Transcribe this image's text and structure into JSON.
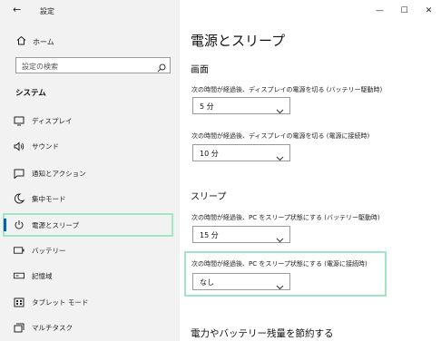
{
  "titlebar": {
    "back_glyph": "←",
    "app_title": "設定"
  },
  "window_controls": {
    "minimize": "—",
    "maximize": "☐",
    "close": "✕"
  },
  "sidebar": {
    "home_label": "ホーム",
    "search_placeholder": "設定の検索",
    "section_title": "システム",
    "items": [
      {
        "label": "ディスプレイ",
        "icon": "monitor-icon"
      },
      {
        "label": "サウンド",
        "icon": "speaker-icon"
      },
      {
        "label": "通知とアクション",
        "icon": "notification-icon"
      },
      {
        "label": "集中モード",
        "icon": "moon-icon"
      },
      {
        "label": "電源とスリープ",
        "icon": "power-icon",
        "selected": true
      },
      {
        "label": "バッテリー",
        "icon": "battery-icon"
      },
      {
        "label": "記憶域",
        "icon": "storage-icon"
      },
      {
        "label": "タブレット モード",
        "icon": "tablet-icon"
      },
      {
        "label": "マルチタスク",
        "icon": "multitask-icon"
      }
    ]
  },
  "main": {
    "page_title": "電源とスリープ",
    "screen": {
      "heading": "画面",
      "battery_label": "次の時間が経過後、ディスプレイの電源を切る (バッテリー駆動時)",
      "battery_value": "5 分",
      "plugged_label": "次の時間が経過後、ディスプレイの電源を切る (電源に接続時)",
      "plugged_value": "10 分"
    },
    "sleep": {
      "heading": "スリープ",
      "battery_label": "次の時間が経過後、PC をスリープ状態にする (バッテリー駆動時)",
      "battery_value": "15 分",
      "plugged_label": "次の時間が経過後、PC をスリープ状態にする (電源に接続時)",
      "plugged_value": "なし"
    },
    "bottom_title": "電力やバッテリー残量を節約する"
  },
  "colors": {
    "accent": "#0063b1",
    "highlight": "#9ee6c4",
    "sidebar_bg": "#f2f2f2"
  }
}
